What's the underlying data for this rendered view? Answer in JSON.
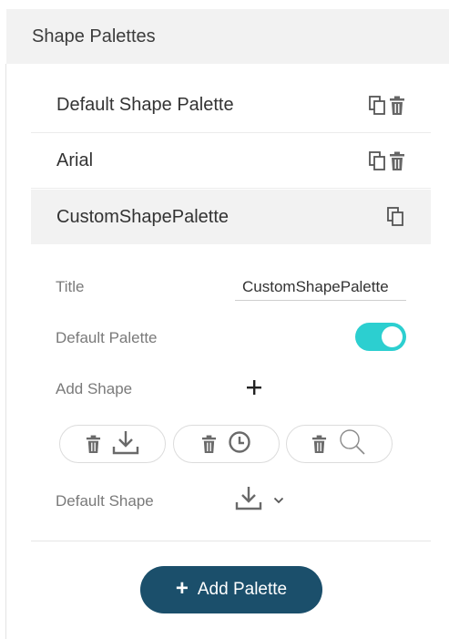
{
  "header": {
    "title": "Shape Palettes"
  },
  "palettes": [
    {
      "name": "Default Shape Palette"
    },
    {
      "name": "Arial"
    },
    {
      "name": "CustomShapePalette"
    }
  ],
  "editor": {
    "title_label": "Title",
    "title_value": "CustomShapePalette",
    "default_palette_label": "Default Palette",
    "default_palette_on": true,
    "add_shape_label": "Add Shape",
    "shapes": [
      {
        "icon": "download-icon"
      },
      {
        "icon": "clock-icon"
      },
      {
        "icon": "search-icon"
      }
    ],
    "default_shape_label": "Default Shape",
    "default_shape_icon": "download-icon"
  },
  "add_palette_button": {
    "label": "Add Palette"
  },
  "colors": {
    "accent_toggle": "#2ccfd0",
    "button": "#1b4f6b"
  }
}
